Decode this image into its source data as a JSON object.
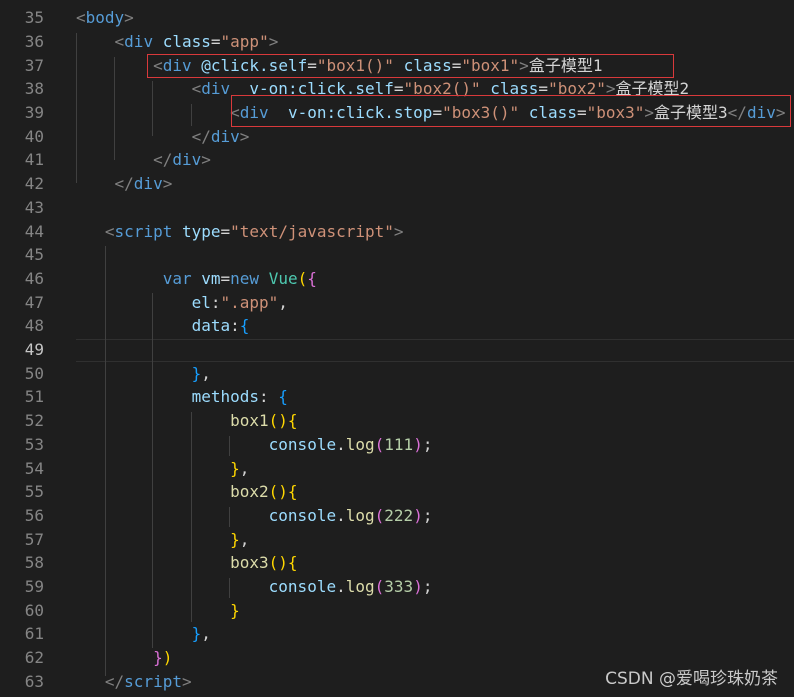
{
  "editor": {
    "active_line": "49",
    "lines": [
      {
        "n": "35",
        "tokens": [
          [
            "t-punct",
            "<"
          ],
          [
            "t-tag",
            "body"
          ],
          [
            "t-punct",
            ">"
          ]
        ]
      },
      {
        "n": "36",
        "tokens": [
          [
            "t-text",
            "    "
          ],
          [
            "t-punct",
            "<"
          ],
          [
            "t-tag",
            "div"
          ],
          [
            "t-text",
            " "
          ],
          [
            "t-attr",
            "class"
          ],
          [
            "t-text",
            "="
          ],
          [
            "t-str",
            "\"app\""
          ],
          [
            "t-punct",
            ">"
          ]
        ]
      },
      {
        "n": "37",
        "tokens": [
          [
            "t-text",
            "        "
          ],
          [
            "t-punct",
            "<"
          ],
          [
            "t-tag",
            "div"
          ],
          [
            "t-text",
            " "
          ],
          [
            "t-attr",
            "@click.self"
          ],
          [
            "t-text",
            "="
          ],
          [
            "t-str",
            "\"box1()\""
          ],
          [
            "t-text",
            " "
          ],
          [
            "t-attr",
            "class"
          ],
          [
            "t-text",
            "="
          ],
          [
            "t-str",
            "\"box1\""
          ],
          [
            "t-punct",
            ">"
          ],
          [
            "t-text",
            "盒子模型1"
          ]
        ]
      },
      {
        "n": "38",
        "tokens": [
          [
            "t-text",
            "            "
          ],
          [
            "t-punct",
            "<"
          ],
          [
            "t-tag",
            "div"
          ],
          [
            "t-text",
            "  "
          ],
          [
            "t-attr",
            "v-on:click.self"
          ],
          [
            "t-text",
            "="
          ],
          [
            "t-str",
            "\"box2()\""
          ],
          [
            "t-text",
            " "
          ],
          [
            "t-attr",
            "class"
          ],
          [
            "t-text",
            "="
          ],
          [
            "t-str",
            "\"box2\""
          ],
          [
            "t-punct",
            ">"
          ],
          [
            "t-text",
            "盒子模型2"
          ]
        ]
      },
      {
        "n": "39",
        "tokens": [
          [
            "t-text",
            "                "
          ],
          [
            "t-punct",
            "<"
          ],
          [
            "t-tag",
            "div"
          ],
          [
            "t-text",
            "  "
          ],
          [
            "t-attr",
            "v-on:click.stop"
          ],
          [
            "t-text",
            "="
          ],
          [
            "t-str",
            "\"box3()\""
          ],
          [
            "t-text",
            " "
          ],
          [
            "t-attr",
            "class"
          ],
          [
            "t-text",
            "="
          ],
          [
            "t-str",
            "\"box3\""
          ],
          [
            "t-punct",
            ">"
          ],
          [
            "t-text",
            "盒子模型3"
          ],
          [
            "t-punct",
            "</"
          ],
          [
            "t-tag",
            "div"
          ],
          [
            "t-punct",
            ">"
          ]
        ]
      },
      {
        "n": "40",
        "tokens": [
          [
            "t-text",
            "            "
          ],
          [
            "t-punct",
            "</"
          ],
          [
            "t-tag",
            "div"
          ],
          [
            "t-punct",
            ">"
          ]
        ]
      },
      {
        "n": "41",
        "tokens": [
          [
            "t-text",
            "        "
          ],
          [
            "t-punct",
            "</"
          ],
          [
            "t-tag",
            "div"
          ],
          [
            "t-punct",
            ">"
          ]
        ]
      },
      {
        "n": "42",
        "tokens": [
          [
            "t-text",
            "    "
          ],
          [
            "t-punct",
            "</"
          ],
          [
            "t-tag",
            "div"
          ],
          [
            "t-punct",
            ">"
          ]
        ]
      },
      {
        "n": "43",
        "tokens": []
      },
      {
        "n": "44",
        "tokens": [
          [
            "t-text",
            "   "
          ],
          [
            "t-punct",
            "<"
          ],
          [
            "t-tag",
            "script"
          ],
          [
            "t-text",
            " "
          ],
          [
            "t-attr",
            "type"
          ],
          [
            "t-text",
            "="
          ],
          [
            "t-str",
            "\"text/javascript\""
          ],
          [
            "t-punct",
            ">"
          ]
        ]
      },
      {
        "n": "45",
        "tokens": []
      },
      {
        "n": "46",
        "tokens": [
          [
            "t-text",
            "         "
          ],
          [
            "t-kw",
            "var"
          ],
          [
            "t-text",
            " "
          ],
          [
            "t-var",
            "vm"
          ],
          [
            "t-op",
            "="
          ],
          [
            "t-kw",
            "new"
          ],
          [
            "t-text",
            " "
          ],
          [
            "t-cls",
            "Vue"
          ],
          [
            "t-brace1",
            "("
          ],
          [
            "t-brace2",
            "{"
          ]
        ]
      },
      {
        "n": "47",
        "tokens": [
          [
            "t-text",
            "            "
          ],
          [
            "t-prop",
            "el"
          ],
          [
            "t-text",
            ":"
          ],
          [
            "t-str",
            "\".app\""
          ],
          [
            "t-text",
            ","
          ]
        ]
      },
      {
        "n": "48",
        "tokens": [
          [
            "t-text",
            "            "
          ],
          [
            "t-prop",
            "data"
          ],
          [
            "t-text",
            ":"
          ],
          [
            "t-brace3",
            "{"
          ]
        ]
      },
      {
        "n": "49",
        "tokens": []
      },
      {
        "n": "50",
        "tokens": [
          [
            "t-text",
            "            "
          ],
          [
            "t-brace3",
            "}"
          ],
          [
            "t-text",
            ","
          ]
        ]
      },
      {
        "n": "51",
        "tokens": [
          [
            "t-text",
            "            "
          ],
          [
            "t-prop",
            "methods"
          ],
          [
            "t-text",
            ": "
          ],
          [
            "t-brace3",
            "{"
          ]
        ]
      },
      {
        "n": "52",
        "tokens": [
          [
            "t-text",
            "                "
          ],
          [
            "t-fn",
            "box1"
          ],
          [
            "t-brace1",
            "()"
          ],
          [
            "t-brace1",
            "{"
          ]
        ]
      },
      {
        "n": "53",
        "tokens": [
          [
            "t-text",
            "                    "
          ],
          [
            "t-var",
            "console"
          ],
          [
            "t-text",
            "."
          ],
          [
            "t-fn",
            "log"
          ],
          [
            "t-brace2",
            "("
          ],
          [
            "t-num",
            "111"
          ],
          [
            "t-brace2",
            ")"
          ],
          [
            "t-text",
            ";"
          ]
        ]
      },
      {
        "n": "54",
        "tokens": [
          [
            "t-text",
            "                "
          ],
          [
            "t-brace1",
            "}"
          ],
          [
            "t-text",
            ","
          ]
        ]
      },
      {
        "n": "55",
        "tokens": [
          [
            "t-text",
            "                "
          ],
          [
            "t-fn",
            "box2"
          ],
          [
            "t-brace1",
            "()"
          ],
          [
            "t-brace1",
            "{"
          ]
        ]
      },
      {
        "n": "56",
        "tokens": [
          [
            "t-text",
            "                    "
          ],
          [
            "t-var",
            "console"
          ],
          [
            "t-text",
            "."
          ],
          [
            "t-fn",
            "log"
          ],
          [
            "t-brace2",
            "("
          ],
          [
            "t-num",
            "222"
          ],
          [
            "t-brace2",
            ")"
          ],
          [
            "t-text",
            ";"
          ]
        ]
      },
      {
        "n": "57",
        "tokens": [
          [
            "t-text",
            "                "
          ],
          [
            "t-brace1",
            "}"
          ],
          [
            "t-text",
            ","
          ]
        ]
      },
      {
        "n": "58",
        "tokens": [
          [
            "t-text",
            "                "
          ],
          [
            "t-fn",
            "box3"
          ],
          [
            "t-brace1",
            "()"
          ],
          [
            "t-brace1",
            "{"
          ]
        ]
      },
      {
        "n": "59",
        "tokens": [
          [
            "t-text",
            "                    "
          ],
          [
            "t-var",
            "console"
          ],
          [
            "t-text",
            "."
          ],
          [
            "t-fn",
            "log"
          ],
          [
            "t-brace2",
            "("
          ],
          [
            "t-num",
            "333"
          ],
          [
            "t-brace2",
            ")"
          ],
          [
            "t-text",
            ";"
          ]
        ]
      },
      {
        "n": "60",
        "tokens": [
          [
            "t-text",
            "                "
          ],
          [
            "t-brace1",
            "}"
          ]
        ]
      },
      {
        "n": "61",
        "tokens": [
          [
            "t-text",
            "            "
          ],
          [
            "t-brace3",
            "}"
          ],
          [
            "t-text",
            ","
          ]
        ]
      },
      {
        "n": "62",
        "tokens": [
          [
            "t-text",
            "        "
          ],
          [
            "t-brace2",
            "}"
          ],
          [
            "t-brace1",
            ")"
          ]
        ]
      },
      {
        "n": "63",
        "tokens": [
          [
            "t-text",
            "   "
          ],
          [
            "t-punct",
            "</"
          ],
          [
            "t-tag",
            "script"
          ],
          [
            "t-punct",
            ">"
          ]
        ]
      }
    ]
  },
  "watermark": "CSDN @爱喝珍珠奶茶"
}
